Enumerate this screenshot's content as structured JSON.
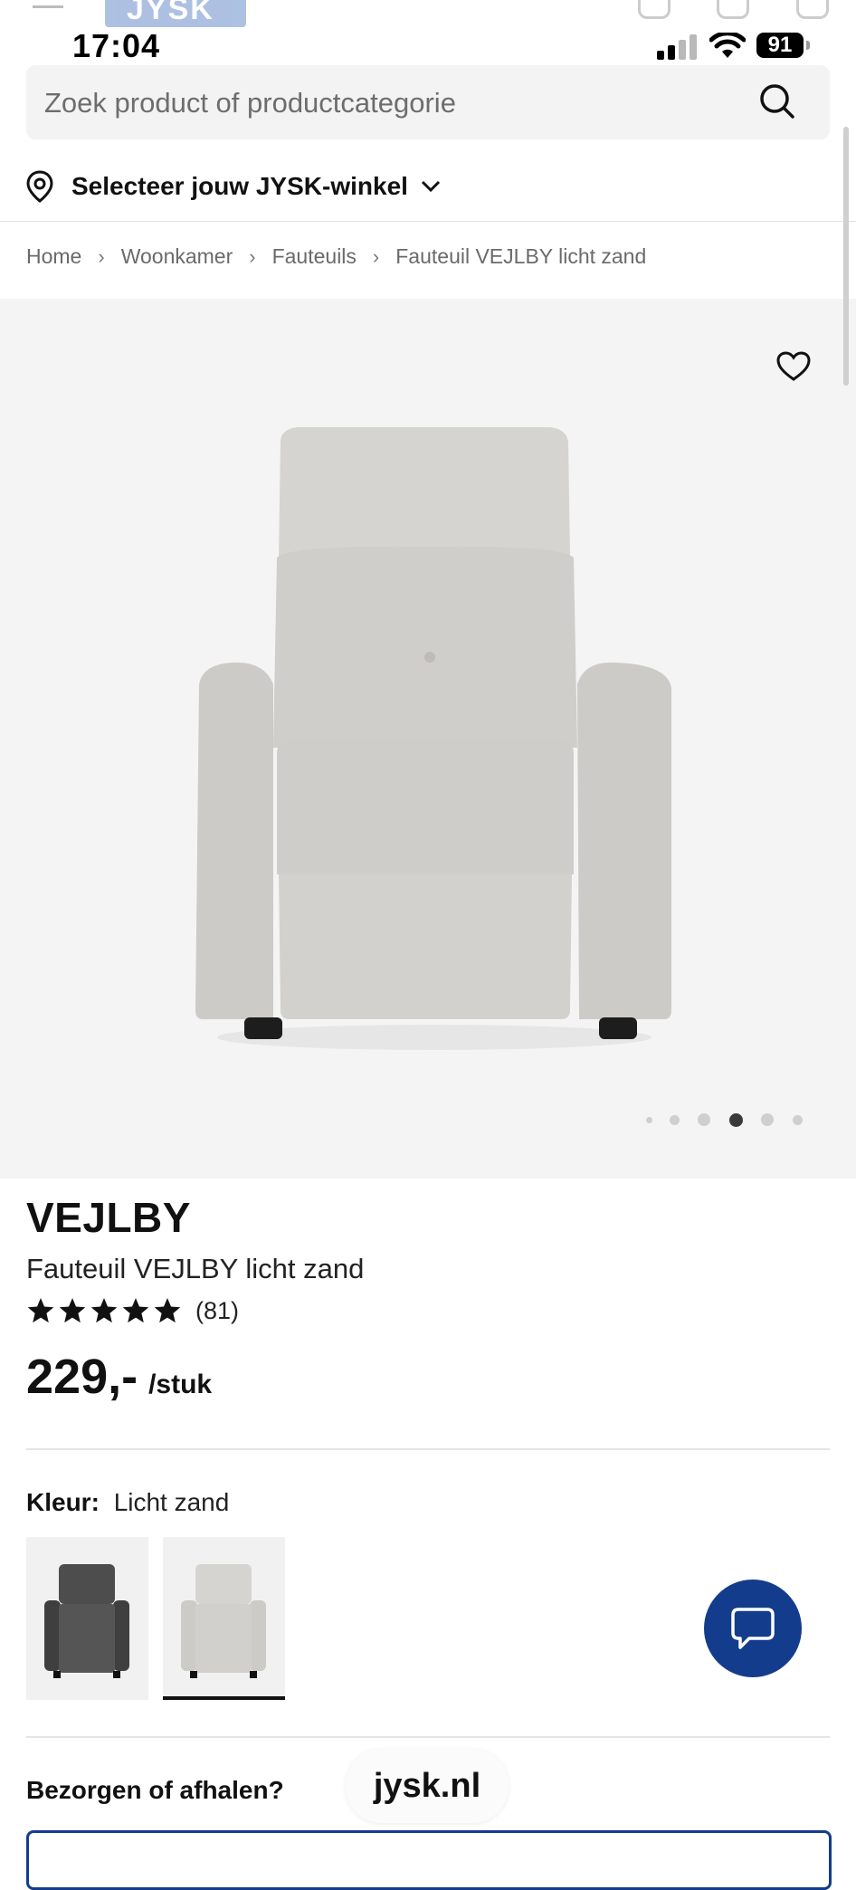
{
  "status": {
    "time": "17:04",
    "battery": "91"
  },
  "search": {
    "placeholder": "Zoek product of productcategorie"
  },
  "store": {
    "label": "Selecteer jouw JYSK-winkel"
  },
  "breadcrumb": [
    "Home",
    "Woonkamer",
    "Fauteuils",
    "Fauteuil VEJLBY licht zand"
  ],
  "gallery": {
    "dots": 6,
    "active_dot": 4
  },
  "product": {
    "brand": "VEJLBY",
    "name": "Fauteuil VEJLBY licht zand",
    "rating_stars": 5,
    "reviews": "(81)",
    "price": "229,-",
    "unit": "/stuk"
  },
  "color": {
    "label": "Kleur:",
    "value": "Licht zand",
    "swatches": [
      {
        "name": "Donkergrijs",
        "tone": "#4a4a4a"
      },
      {
        "name": "Licht zand",
        "tone": "#d8d6d2",
        "selected": true
      }
    ]
  },
  "delivery": {
    "label": "Bezorgen of afhalen?"
  },
  "browser": {
    "url": "jysk.nl"
  },
  "colors": {
    "accent": "#143c8c",
    "gallery_bg": "#f4f4f4"
  },
  "behind_header": {
    "logo": "JYSK"
  }
}
